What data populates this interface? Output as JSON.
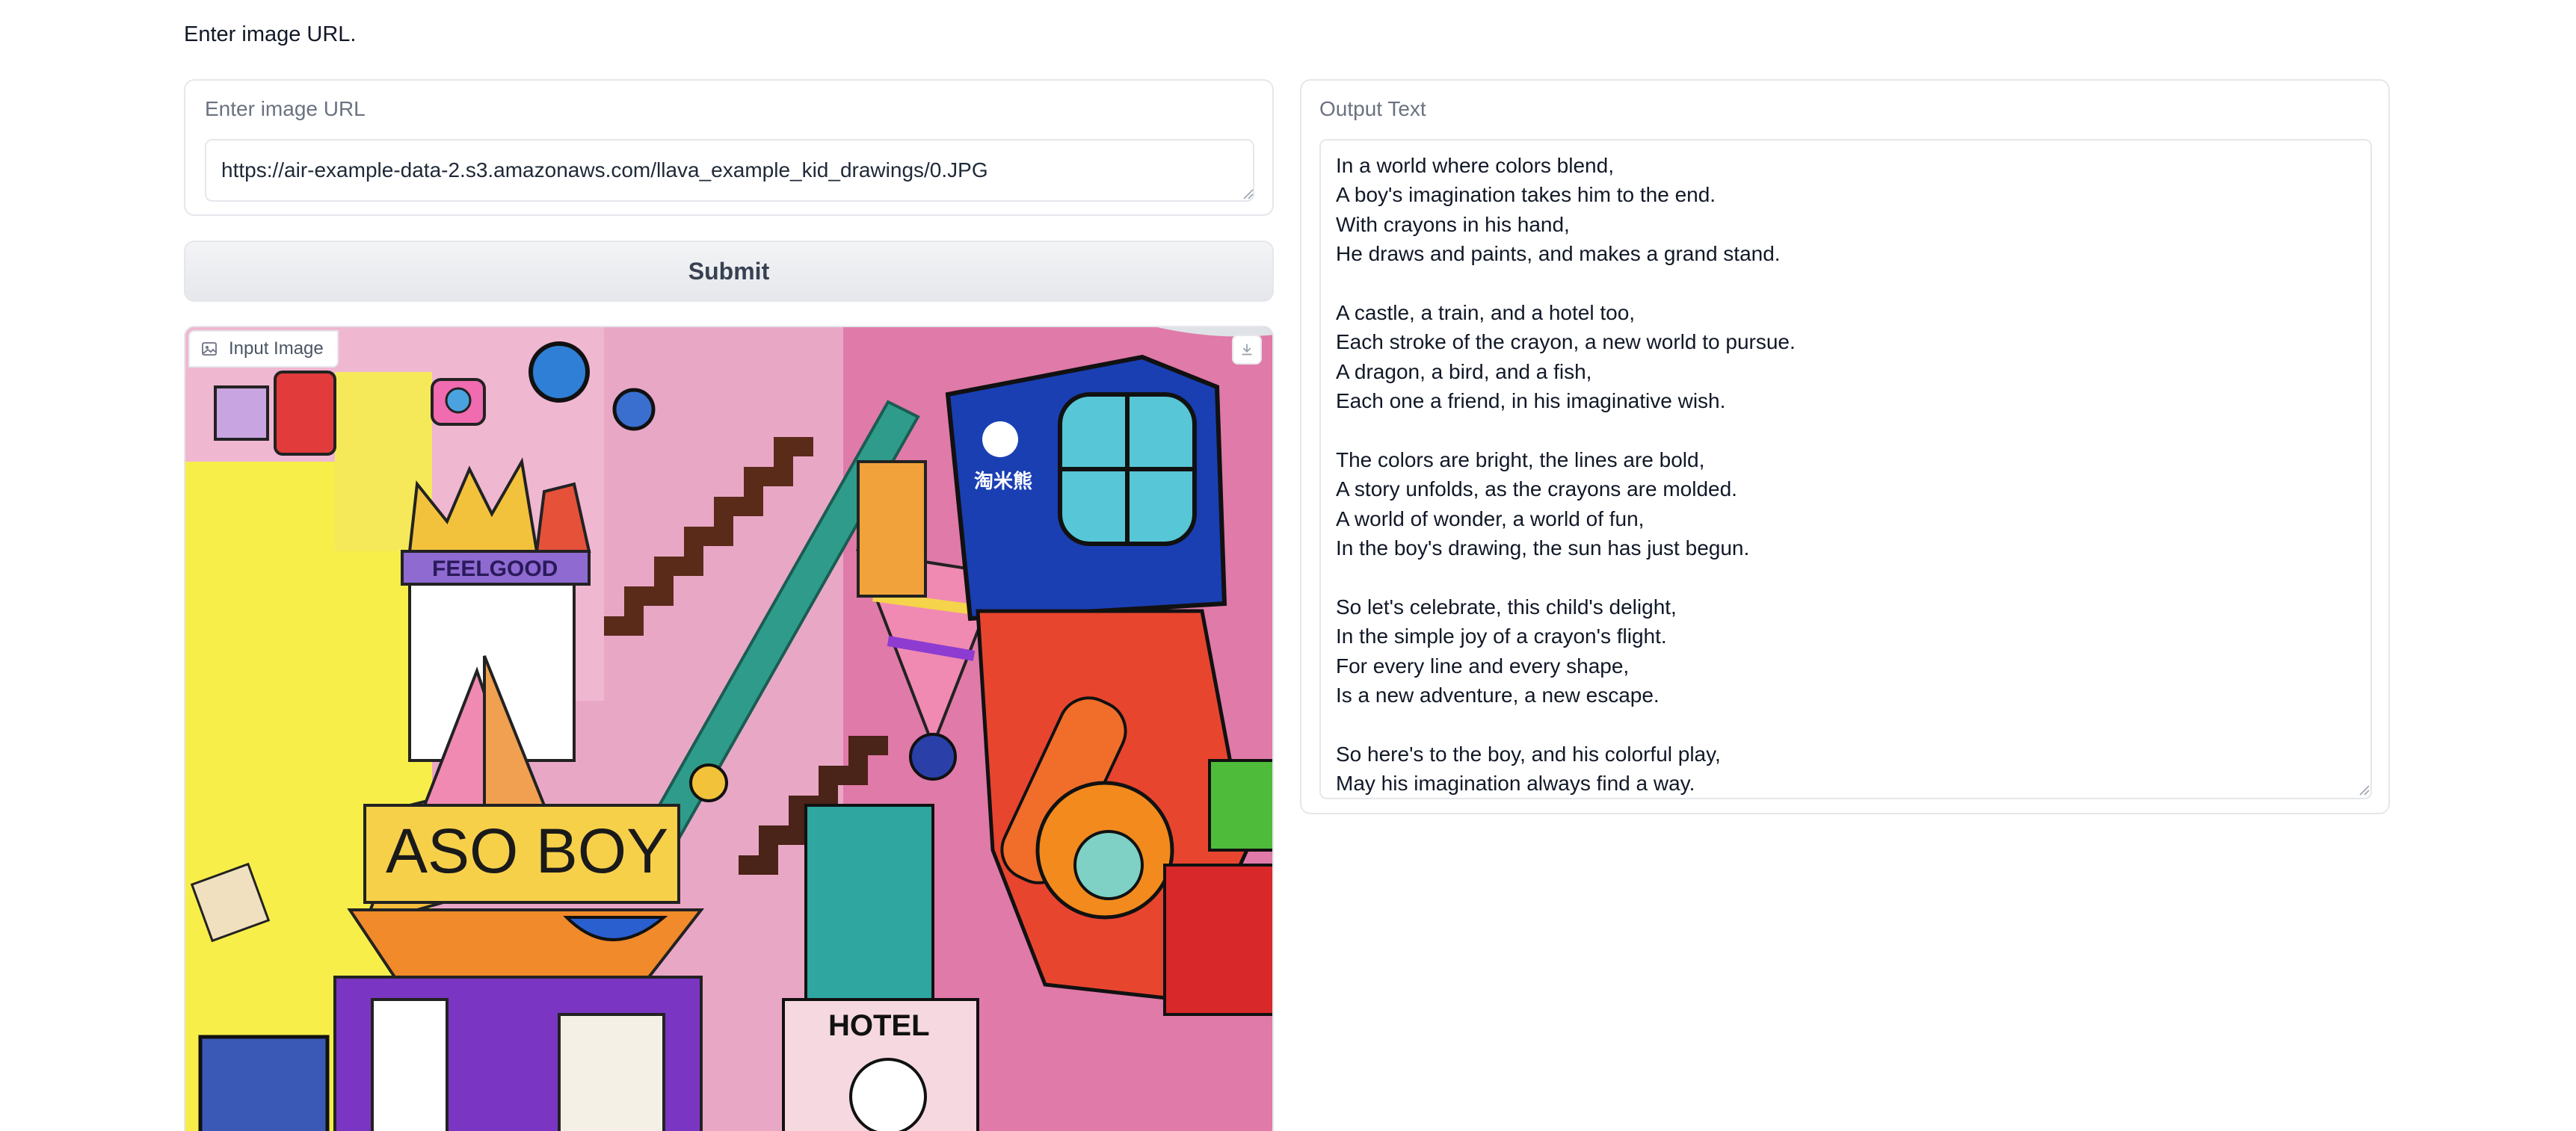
{
  "page": {
    "heading": "Enter image URL."
  },
  "url_input": {
    "label": "Enter image URL",
    "value": "https://air-example-data-2.s3.amazonaws.com/llava_example_kid_drawings/0.JPG"
  },
  "submit": {
    "label": "Submit"
  },
  "input_image": {
    "label": "Input Image",
    "drawing_texts": {
      "sign_main": "ASO BOY",
      "sign_feel": "FEELGOOD",
      "sign_hotel": "HOTEL",
      "brand": "淘米熊"
    }
  },
  "output": {
    "label": "Output Text",
    "lines": [
      "In a world where colors blend,",
      "A boy's imagination takes him to the end.",
      "With crayons in his hand,",
      "He draws and paints, and makes a grand stand.",
      "",
      "A castle, a train, and a hotel too,",
      "Each stroke of the crayon, a new world to pursue.",
      "A dragon, a bird, and a fish,",
      "Each one a friend, in his imaginative wish.",
      "",
      "The colors are bright, the lines are bold,",
      "A story unfolds, as the crayons are molded.",
      "A world of wonder, a world of fun,",
      "In the boy's drawing, the sun has just begun.",
      "",
      "So let's celebrate, this child's delight,",
      "In the simple joy of a crayon's flight.",
      "For every line and every shape,",
      "Is a new adventure, a new escape.",
      "",
      "So here's to the boy, and his colorful play,",
      "May his imagination always find a way."
    ]
  },
  "colors": {
    "border": "#e5e7eb",
    "label": "#6b7280",
    "button_bg": "#e5e7eb"
  },
  "icons": {
    "image_label": "image-icon",
    "download": "download-icon"
  }
}
